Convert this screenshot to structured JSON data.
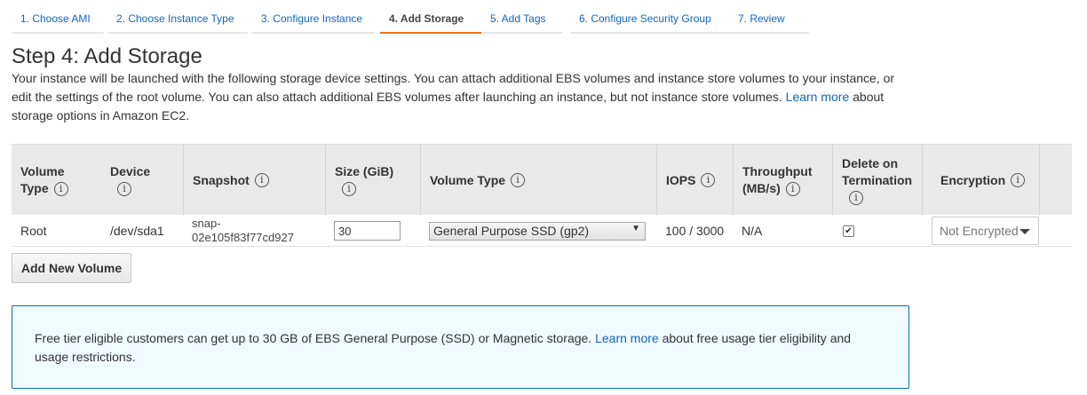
{
  "wizard": {
    "steps": [
      {
        "label": "1. Choose AMI"
      },
      {
        "label": "2. Choose Instance Type"
      },
      {
        "label": "3. Configure Instance"
      },
      {
        "label": "4. Add Storage"
      },
      {
        "label": "5. Add Tags"
      },
      {
        "label": "6. Configure Security Group"
      },
      {
        "label": "7. Review"
      }
    ],
    "active_step": 4
  },
  "page": {
    "title": "Step 4: Add Storage",
    "description_part1": "Your instance will be launched with the following storage device settings. You can attach additional EBS volumes and instance store volumes to your instance, or edit the settings of the root volume. You can also attach additional EBS volumes after launching an instance, but not instance store volumes.",
    "learn_more": "Learn more",
    "description_part2": "about storage options in Amazon EC2."
  },
  "table": {
    "headers": {
      "volume_type_1": "Volume",
      "volume_type_2": "Type",
      "device": "Device",
      "snapshot": "Snapshot",
      "size": "Size (GiB)",
      "vtype": "Volume Type",
      "iops": "IOPS",
      "throughput_1": "Throughput",
      "throughput_2": "(MB/s)",
      "delete_1": "Delete on",
      "delete_2": "Termination",
      "encryption": "Encryption"
    },
    "info_glyph": "i",
    "row": {
      "volume_type": "Root",
      "device": "/dev/sda1",
      "snapshot_1": "snap-",
      "snapshot_2": "02e105f83f77cd927",
      "size": "30",
      "vtype": "General Purpose SSD (gp2)",
      "iops": "100 / 3000",
      "throughput": "N/A",
      "delete_on_termination": true,
      "check_glyph": "✔",
      "encryption": "Not Encrypted"
    }
  },
  "add_volume_label": "Add New Volume",
  "notice": {
    "text1": "Free tier eligible customers can get up to 30 GB of EBS General Purpose (SSD) or Magnetic storage.",
    "learn_more": "Learn more",
    "text2": "about free usage tier eligibility and usage restrictions."
  },
  "colors": {
    "link": "#1166bb",
    "active_tab_underline": "#ec7211",
    "notice_border": "#0073bb",
    "notice_bg": "#f1faff"
  }
}
